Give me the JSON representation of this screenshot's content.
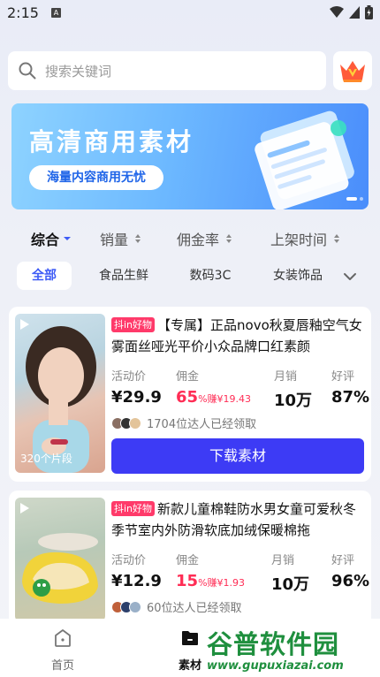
{
  "status": {
    "time": "2:15",
    "notif_letter": "A"
  },
  "search": {
    "placeholder": "搜索关键词"
  },
  "banner": {
    "title": "高清商用素材",
    "pill": "海量内容商用无忧"
  },
  "sort": [
    {
      "label": "综合",
      "icon": "triangle-down-icon"
    },
    {
      "label": "销量",
      "icon": "sort-arrows-icon"
    },
    {
      "label": "佣金率",
      "icon": "sort-arrows-icon"
    },
    {
      "label": "上架时间",
      "icon": "sort-arrows-icon"
    }
  ],
  "categories": [
    "全部",
    "食品生鲜",
    "数码3C",
    "女装饰品"
  ],
  "products": [
    {
      "tag": "抖in好物",
      "title": "【专属】正品novo秋夏唇釉空气女雾面丝哑光平价小众品牌口红素颜",
      "clips": "320个片段",
      "price_label": "活动价",
      "price": "¥29.9",
      "commission_label": "佣金",
      "commission_pct": "65",
      "commission_note": "%赚¥19.43",
      "sales_label": "月销",
      "sales": "10万",
      "rating_label": "好评",
      "rating": "87%",
      "creators": "1704位达人已经领取",
      "download": "下载素材"
    },
    {
      "tag": "抖in好物",
      "title": "新款儿童棉鞋防水男女童可爱秋冬季节室内外防滑软底加绒保暖棉拖",
      "price_label": "活动价",
      "price": "¥12.9",
      "commission_label": "佣金",
      "commission_pct": "15",
      "commission_note": "%赚¥1.93",
      "sales_label": "月销",
      "sales": "10万",
      "rating_label": "好评",
      "rating": "96%",
      "creators": "60位达人已经领取"
    }
  ],
  "tabs": [
    {
      "label": "首页",
      "icon": "home-icon"
    },
    {
      "label": "素材",
      "icon": "folder-icon"
    }
  ],
  "watermark": {
    "main": "谷普软件园",
    "url": "www.gupuxiazai.com"
  },
  "colors": {
    "accent": "#3d3bf5",
    "pink": "#ff2d55"
  }
}
